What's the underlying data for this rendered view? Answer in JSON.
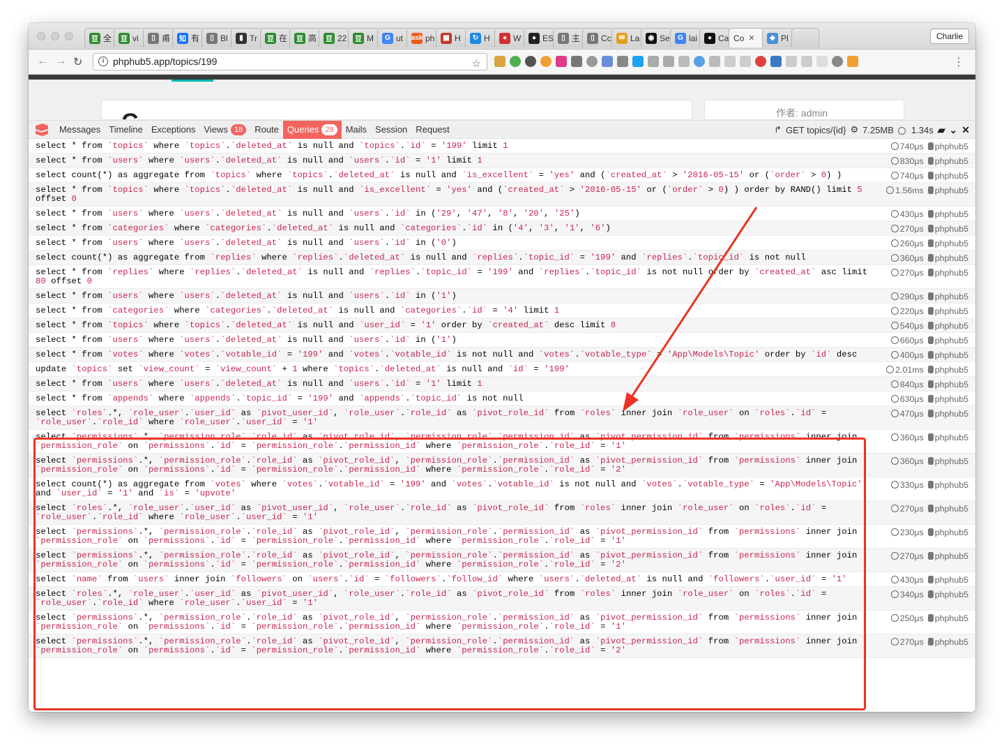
{
  "browser": {
    "tabs": [
      {
        "label": "全",
        "color": "#2e8b2e",
        "glyph": "豆"
      },
      {
        "label": "vi",
        "color": "#2e8b2e",
        "glyph": "豆"
      },
      {
        "label": "甫",
        "color": "#777777",
        "glyph": "▯"
      },
      {
        "label": "有",
        "color": "#1772f6",
        "glyph": "知"
      },
      {
        "label": "Bl",
        "color": "#777777",
        "glyph": "▯"
      },
      {
        "label": "Tr",
        "color": "#333333",
        "glyph": "▮"
      },
      {
        "label": "在",
        "color": "#2e8b2e",
        "glyph": "豆"
      },
      {
        "label": "高",
        "color": "#2e8b2e",
        "glyph": "豆"
      },
      {
        "label": "22",
        "color": "#2e8b2e",
        "glyph": "豆"
      },
      {
        "label": "M",
        "color": "#2e8b2e",
        "glyph": "豆"
      },
      {
        "label": "ut",
        "color": "#4285f4",
        "glyph": "G"
      },
      {
        "label": "ph",
        "color": "#e65c1a",
        "glyph": "ask"
      },
      {
        "label": "H",
        "color": "#c0392b",
        "glyph": "▦"
      },
      {
        "label": "H",
        "color": "#1e88e5",
        "glyph": "↻"
      },
      {
        "label": "W",
        "color": "#d32f2f",
        "glyph": "●"
      },
      {
        "label": "ES",
        "color": "#222222",
        "glyph": "●"
      },
      {
        "label": "主",
        "color": "#777777",
        "glyph": "▯"
      },
      {
        "label": "Cc",
        "color": "#777777",
        "glyph": "▯"
      },
      {
        "label": "La",
        "color": "#e0a020",
        "glyph": "✉"
      },
      {
        "label": "Se",
        "color": "#111111",
        "glyph": "◉"
      },
      {
        "label": "lai",
        "color": "#4285f4",
        "glyph": "G"
      },
      {
        "label": "Ca",
        "color": "#111111",
        "glyph": "●"
      },
      {
        "label": "Co",
        "color": "#888888",
        "glyph": "",
        "active": true
      },
      {
        "label": "Pl",
        "color": "#4a90d9",
        "glyph": "◆"
      },
      {
        "label": "",
        "color": "#cccccc",
        "glyph": ""
      }
    ],
    "profile": "Charlie",
    "url": "phphub5.app/topics/199"
  },
  "page": {
    "title_fragment": "C",
    "author": "作者: admin"
  },
  "debugbar": {
    "tabs": [
      {
        "label": "Messages"
      },
      {
        "label": "Timeline"
      },
      {
        "label": "Exceptions"
      },
      {
        "label": "Views",
        "badge": "18"
      },
      {
        "label": "Route"
      },
      {
        "label": "Queries",
        "badge": "29",
        "active": true
      },
      {
        "label": "Mails"
      },
      {
        "label": "Session"
      },
      {
        "label": "Request"
      }
    ],
    "route": "GET topics/{id}",
    "memory": "7.25MB",
    "time": "1.34s"
  },
  "queries": [
    {
      "sql": "select * from `topics` where `topics`.`deleted_at` is null and `topics`.`id` = '199' limit 1",
      "time": "740μs",
      "conn": "phphub5"
    },
    {
      "sql": "select * from `users` where `users`.`deleted_at` is null and `users`.`id` = '1' limit 1",
      "time": "830μs",
      "conn": "phphub5"
    },
    {
      "sql": "select count(*) as aggregate from `topics` where `topics`.`deleted_at` is null and `is_excellent` = 'yes' and (`created_at` > '2016-05-15' or (`order` > 0) )",
      "time": "740μs",
      "conn": "phphub5"
    },
    {
      "sql": "select * from `topics` where `topics`.`deleted_at` is null and `is_excellent` = 'yes' and (`created_at` > '2016-05-15' or (`order` > 0) ) order by RAND() limit 5 offset 0",
      "time": "1.56ms",
      "conn": "phphub5"
    },
    {
      "sql": "select * from `users` where `users`.`deleted_at` is null and `users`.`id` in ('29', '47', '8', '20', '25')",
      "time": "430μs",
      "conn": "phphub5"
    },
    {
      "sql": "select * from `categories` where `categories`.`deleted_at` is null and `categories`.`id` in ('4', '3', '1', '6')",
      "time": "270μs",
      "conn": "phphub5"
    },
    {
      "sql": "select * from `users` where `users`.`deleted_at` is null and `users`.`id` in ('0')",
      "time": "260μs",
      "conn": "phphub5"
    },
    {
      "sql": "select count(*) as aggregate from `replies` where `replies`.`deleted_at` is null and `replies`.`topic_id` = '199' and `replies`.`topic_id` is not null",
      "time": "360μs",
      "conn": "phphub5"
    },
    {
      "sql": "select * from `replies` where `replies`.`deleted_at` is null and `replies`.`topic_id` = '199' and `replies`.`topic_id` is not null order by `created_at` asc limit 80 offset 0",
      "time": "270μs",
      "conn": "phphub5"
    },
    {
      "sql": "select * from `users` where `users`.`deleted_at` is null and `users`.`id` in ('1')",
      "time": "290μs",
      "conn": "phphub5"
    },
    {
      "sql": "select * from `categories` where `categories`.`deleted_at` is null and `categories`.`id` = '4' limit 1",
      "time": "220μs",
      "conn": "phphub5"
    },
    {
      "sql": "select * from `topics` where `topics`.`deleted_at` is null and `user_id` = '1' order by `created_at` desc limit 8",
      "time": "540μs",
      "conn": "phphub5"
    },
    {
      "sql": "select * from `users` where `users`.`deleted_at` is null and `users`.`id` in ('1')",
      "time": "660μs",
      "conn": "phphub5"
    },
    {
      "sql": "select * from `votes` where `votes`.`votable_id` = '199' and `votes`.`votable_id` is not null and `votes`.`votable_type` = 'App\\Models\\Topic' order by `id` desc",
      "time": "400μs",
      "conn": "phphub5"
    },
    {
      "sql": "update `topics` set `view_count` = `view_count` + 1 where `topics`.`deleted_at` is null and `id` = '199'",
      "time": "2.01ms",
      "conn": "phphub5"
    },
    {
      "sql": "select * from `users` where `users`.`deleted_at` is null and `users`.`id` = '1' limit 1",
      "time": "840μs",
      "conn": "phphub5"
    },
    {
      "sql": "select * from `appends` where `appends`.`topic_id` = '199' and `appends`.`topic_id` is not null",
      "time": "630μs",
      "conn": "phphub5"
    },
    {
      "sql": "select `roles`.*, `role_user`.`user_id` as `pivot_user_id`, `role_user`.`role_id` as `pivot_role_id` from `roles` inner join `role_user` on `roles`.`id` = `role_user`.`role_id` where `role_user`.`user_id` = '1'",
      "time": "470μs",
      "conn": "phphub5"
    },
    {
      "sql": "select `permissions`.*, `permission_role`.`role_id` as `pivot_role_id`, `permission_role`.`permission_id` as `pivot_permission_id` from `permissions` inner join `permission_role` on `permissions`.`id` = `permission_role`.`permission_id` where `permission_role`.`role_id` = '1'",
      "time": "360μs",
      "conn": "phphub5"
    },
    {
      "sql": "select `permissions`.*, `permission_role`.`role_id` as `pivot_role_id`, `permission_role`.`permission_id` as `pivot_permission_id` from `permissions` inner join `permission_role` on `permissions`.`id` = `permission_role`.`permission_id` where `permission_role`.`role_id` = '2'",
      "time": "360μs",
      "conn": "phphub5"
    },
    {
      "sql": "select count(*) as aggregate from `votes` where `votes`.`votable_id` = '199' and `votes`.`votable_id` is not null and `votes`.`votable_type` = 'App\\Models\\Topic' and `user_id` = '1' and `is` = 'upvote'",
      "time": "330μs",
      "conn": "phphub5"
    },
    {
      "sql": "select `roles`.*, `role_user`.`user_id` as `pivot_user_id`, `role_user`.`role_id` as `pivot_role_id` from `roles` inner join `role_user` on `roles`.`id` = `role_user`.`role_id` where `role_user`.`user_id` = '1'",
      "time": "270μs",
      "conn": "phphub5"
    },
    {
      "sql": "select `permissions`.*, `permission_role`.`role_id` as `pivot_role_id`, `permission_role`.`permission_id` as `pivot_permission_id` from `permissions` inner join `permission_role` on `permissions`.`id` = `permission_role`.`permission_id` where `permission_role`.`role_id` = '1'",
      "time": "230μs",
      "conn": "phphub5"
    },
    {
      "sql": "select `permissions`.*, `permission_role`.`role_id` as `pivot_role_id`, `permission_role`.`permission_id` as `pivot_permission_id` from `permissions` inner join `permission_role` on `permissions`.`id` = `permission_role`.`permission_id` where `permission_role`.`role_id` = '2'",
      "time": "270μs",
      "conn": "phphub5"
    },
    {
      "sql": "select `name` from `users` inner join `followers` on `users`.`id` = `followers`.`follow_id` where `users`.`deleted_at` is null and `followers`.`user_id` = '1'",
      "time": "430μs",
      "conn": "phphub5"
    },
    {
      "sql": "select `roles`.*, `role_user`.`user_id` as `pivot_user_id`, `role_user`.`role_id` as `pivot_role_id` from `roles` inner join `role_user` on `roles`.`id` = `role_user`.`role_id` where `role_user`.`user_id` = '1'",
      "time": "340μs",
      "conn": "phphub5"
    },
    {
      "sql": "select `permissions`.*, `permission_role`.`role_id` as `pivot_role_id`, `permission_role`.`permission_id` as `pivot_permission_id` from `permissions` inner join `permission_role` on `permissions`.`id` = `permission_role`.`permission_id` where `permission_role`.`role_id` = '1'",
      "time": "250μs",
      "conn": "phphub5"
    },
    {
      "sql": "select `permissions`.*, `permission_role`.`role_id` as `pivot_role_id`, `permission_role`.`permission_id` as `pivot_permission_id` from `permissions` inner join `permission_role` on `permissions`.`id` = `permission_role`.`permission_id` where `permission_role`.`role_id` = '2'",
      "time": "270μs",
      "conn": "phphub5"
    }
  ],
  "colors": {
    "accent": "#f4645f",
    "annotation": "#ea3323",
    "string": "#c7254e"
  }
}
